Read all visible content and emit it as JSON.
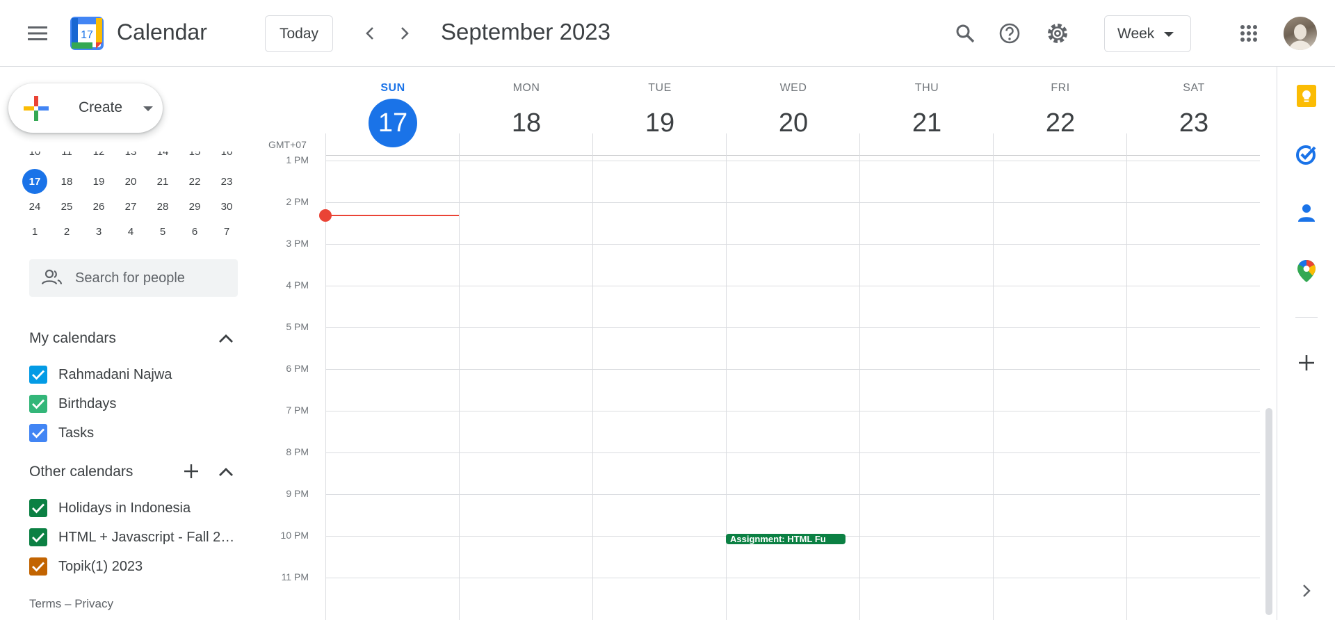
{
  "header": {
    "app_title": "Calendar",
    "logo_day": "17",
    "today_label": "Today",
    "period": "September 2023",
    "view": "Week",
    "icons": [
      "main-menu-icon",
      "search-icon",
      "help-icon",
      "settings-icon",
      "apps-grid-icon"
    ]
  },
  "sidebar": {
    "create_label": "Create",
    "mini_calendar": {
      "rows": [
        [
          "10",
          "11",
          "12",
          "13",
          "14",
          "15",
          "16"
        ],
        [
          "17",
          "18",
          "19",
          "20",
          "21",
          "22",
          "23"
        ],
        [
          "24",
          "25",
          "26",
          "27",
          "28",
          "29",
          "30"
        ],
        [
          "1",
          "2",
          "3",
          "4",
          "5",
          "6",
          "7"
        ]
      ],
      "today": "17"
    },
    "search_people_placeholder": "Search for people",
    "my_calendars": {
      "title": "My calendars",
      "items": [
        {
          "label": "Rahmadani Najwa",
          "color": "#039be5"
        },
        {
          "label": "Birthdays",
          "color": "#33b679"
        },
        {
          "label": "Tasks",
          "color": "#4285f4"
        }
      ]
    },
    "other_calendars": {
      "title": "Other calendars",
      "items": [
        {
          "label": "Holidays in Indonesia",
          "color": "#0b8043"
        },
        {
          "label": "HTML + Javascript - Fall 2…",
          "color": "#0b8043"
        },
        {
          "label": "Topik(1) 2023",
          "color": "#c26401"
        }
      ]
    },
    "footer": {
      "terms": "Terms",
      "separator": "–",
      "privacy": "Privacy"
    }
  },
  "grid": {
    "timezone": "GMT+07",
    "days": [
      {
        "name": "SUN",
        "num": "17",
        "today": true
      },
      {
        "name": "MON",
        "num": "18"
      },
      {
        "name": "TUE",
        "num": "19"
      },
      {
        "name": "WED",
        "num": "20"
      },
      {
        "name": "THU",
        "num": "21"
      },
      {
        "name": "FRI",
        "num": "22"
      },
      {
        "name": "SAT",
        "num": "23"
      }
    ],
    "hours": [
      "1 PM",
      "2 PM",
      "3 PM",
      "4 PM",
      "5 PM",
      "6 PM",
      "7 PM",
      "8 PM",
      "9 PM",
      "10 PM",
      "11 PM"
    ],
    "events": [
      {
        "title": "Assignment: HTML Fu",
        "day": "WED",
        "start": "10 PM",
        "color": "#0b8043"
      }
    ]
  },
  "side_panel": {
    "icons": [
      "keep-icon",
      "tasks-icon",
      "contacts-icon",
      "maps-icon",
      "add-icon",
      "expand-panel-icon"
    ]
  },
  "colors": {
    "accent": "#1a73e8",
    "now_indicator": "#ea4335"
  }
}
